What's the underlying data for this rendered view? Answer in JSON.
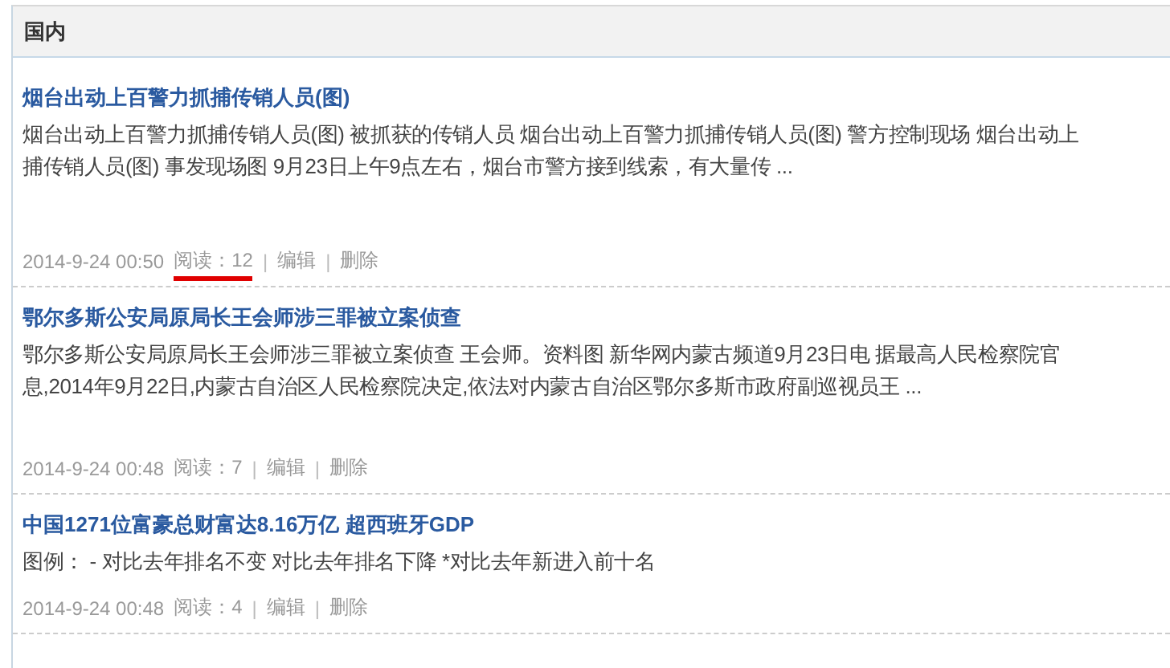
{
  "panel": {
    "title": "国内"
  },
  "articles": [
    {
      "title": "烟台出动上百警力抓捕传销人员(图)",
      "excerpt": [
        "烟台出动上百警力抓捕传销人员(图) 被抓获的传销人员 烟台出动上百警力抓捕传销人员(图) 警方控制现场 烟台出动上",
        "捕传销人员(图) 事发现场图 9月23日上午9点左右，烟台市警方接到线索，有大量传 ..."
      ],
      "date": "2014-9-24 00:50",
      "reads": "阅读：12",
      "underlined": true,
      "actions": [
        "编辑",
        "删除"
      ]
    },
    {
      "title": "鄂尔多斯公安局原局长王会师涉三罪被立案侦查",
      "excerpt": [
        "鄂尔多斯公安局原局长王会师涉三罪被立案侦查 王会师。资料图 新华网内蒙古频道9月23日电 据最高人民检察院官",
        "息,2014年9月22日,内蒙古自治区人民检察院决定,依法对内蒙古自治区鄂尔多斯市政府副巡视员王 ..."
      ],
      "date": "2014-9-24 00:48",
      "reads": "阅读：7",
      "underlined": false,
      "actions": [
        "编辑",
        "删除"
      ]
    },
    {
      "title": "中国1271位富豪总财富达8.16万亿 超西班牙GDP",
      "excerpt": [
        "图例： - 对比去年排名不变 对比去年排名下降 *对比去年新进入前十名"
      ],
      "date": "2014-9-24 00:48",
      "reads": "阅读：4",
      "underlined": false,
      "actions": [
        "编辑",
        "删除"
      ]
    }
  ],
  "separator": "|"
}
